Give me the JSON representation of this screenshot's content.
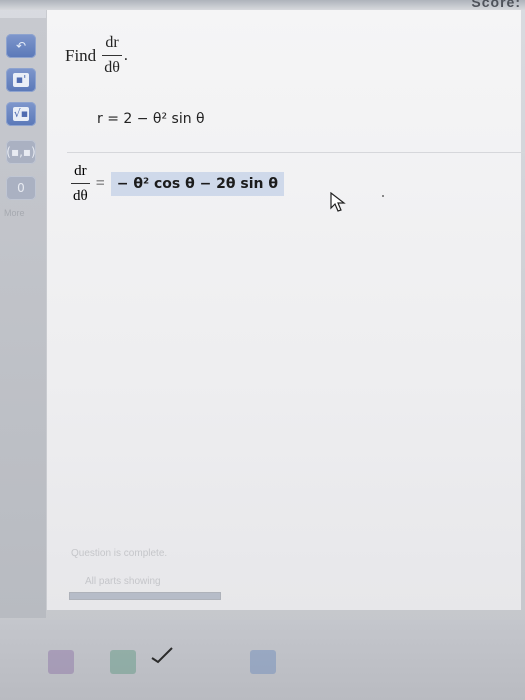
{
  "header": {
    "score_text": "Score:"
  },
  "sidebar": {
    "tools": [
      {
        "name": "undo",
        "glyph": "↶"
      },
      {
        "name": "exponent",
        "glyph": "▪'"
      },
      {
        "name": "sqrt",
        "glyph": "√▪"
      },
      {
        "name": "interval",
        "glyph": "(▪,▪)"
      },
      {
        "name": "zero",
        "glyph": "0"
      }
    ],
    "more_label": "More"
  },
  "question": {
    "find_label": "Find",
    "numerator": "dr",
    "denominator": "dθ",
    "period": ".",
    "given": "r = 2 − θ² sin θ"
  },
  "answer": {
    "numerator": "dr",
    "denominator": "dθ",
    "equals": "=",
    "value": "− θ² cos θ − 2θ sin θ"
  },
  "footer": {
    "status_text": "Question is complete.",
    "progress_text": "All parts showing",
    "progress_value": 1.0
  }
}
